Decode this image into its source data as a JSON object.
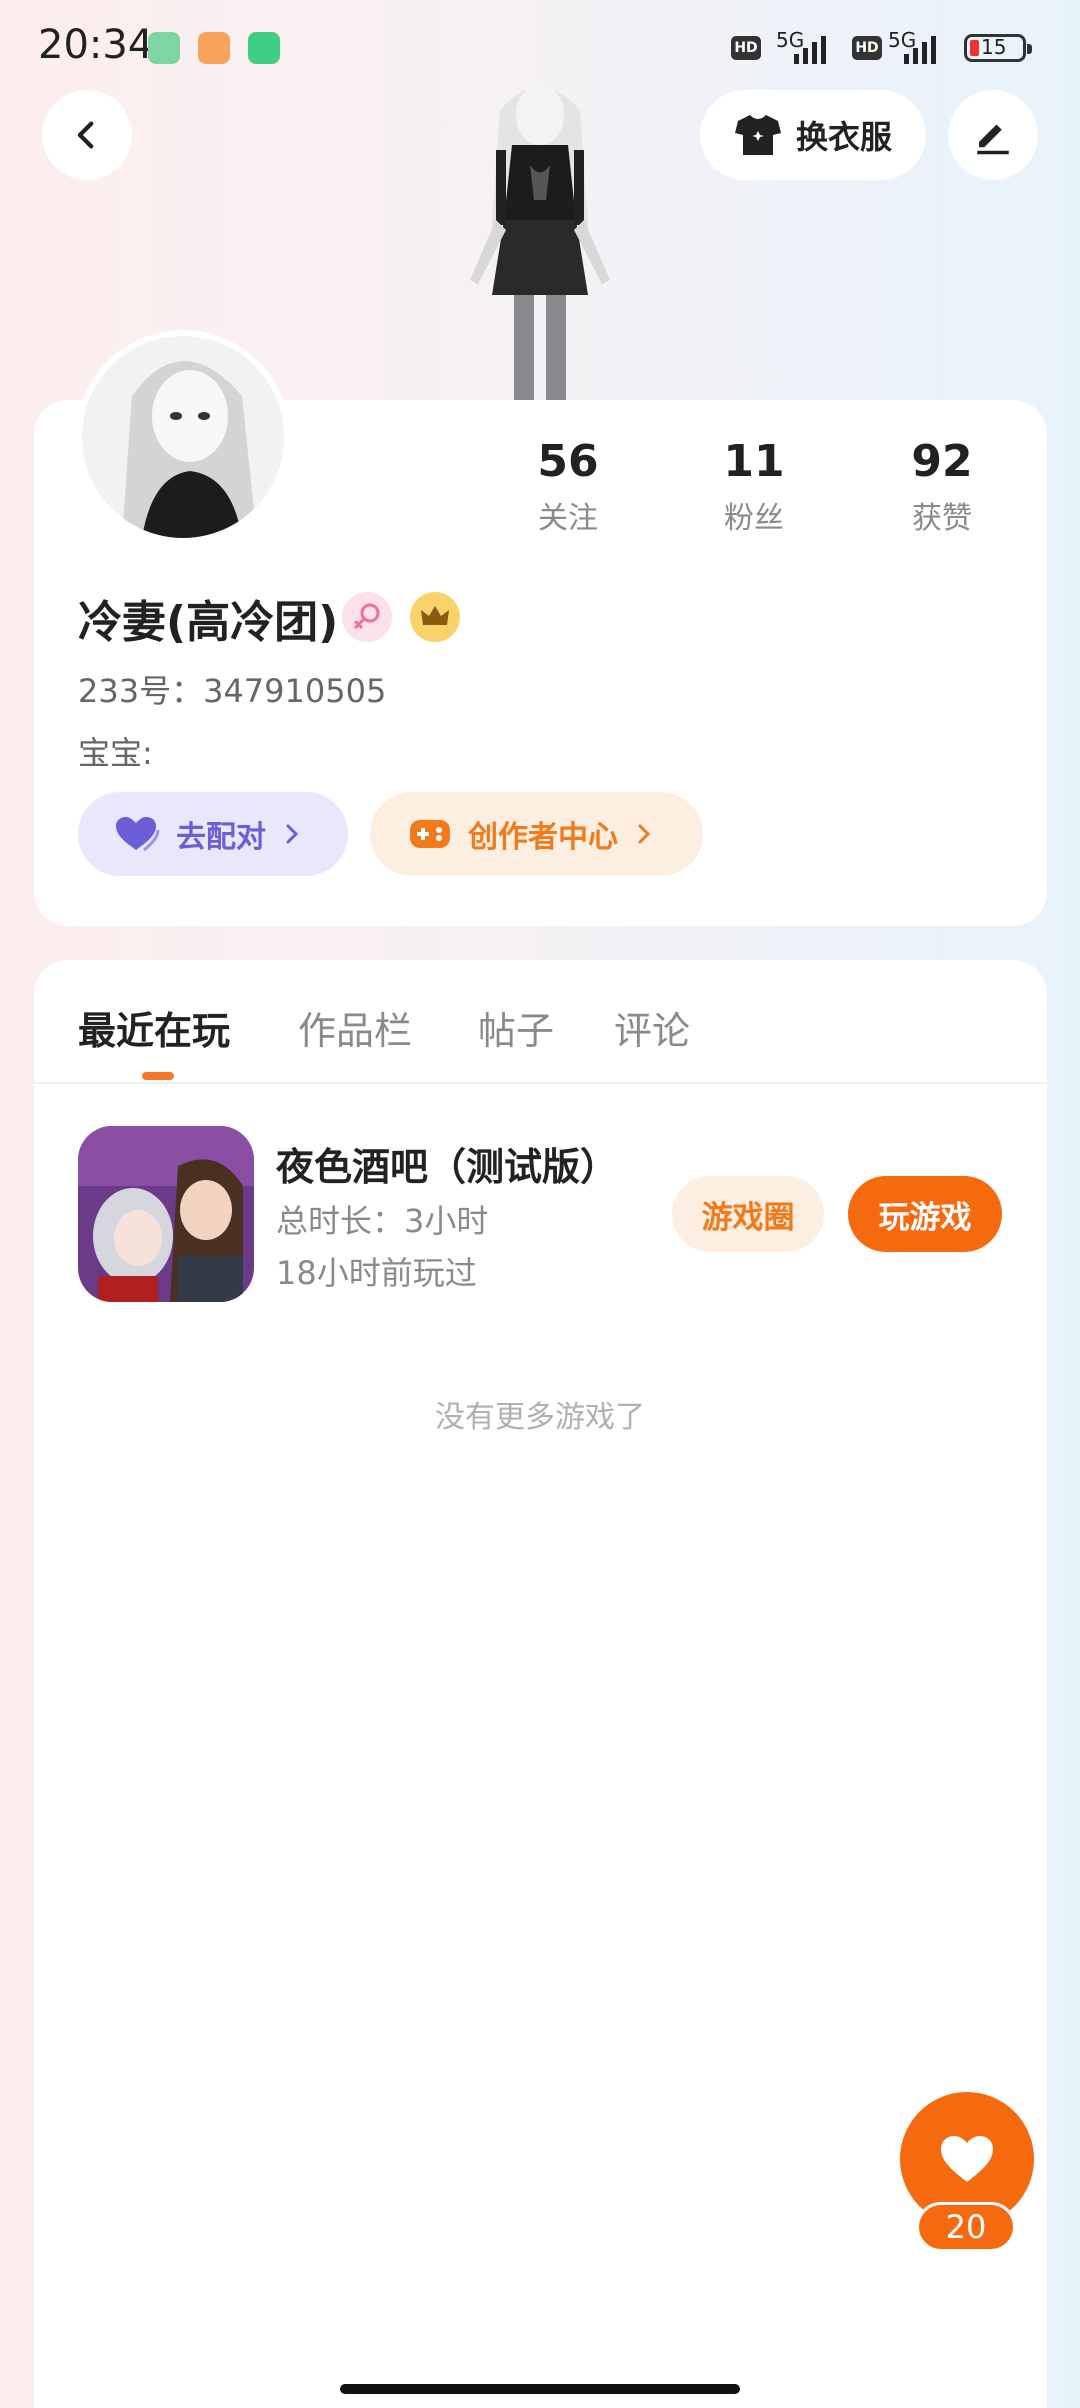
{
  "status_bar": {
    "time": "20:34",
    "net1": "5G",
    "net2": "5G",
    "hd1": "HD",
    "hd2": "HD",
    "battery": "15"
  },
  "header": {
    "dress_label": "换衣服"
  },
  "profile": {
    "stats": [
      {
        "value": "56",
        "label": "关注"
      },
      {
        "value": "11",
        "label": "粉丝"
      },
      {
        "value": "92",
        "label": "获赞"
      }
    ],
    "nickname": "冷妻(高冷团)",
    "uid": "233号：347910505",
    "baby": "宝宝:",
    "match_label": "去配对",
    "creator_label": "创作者中心"
  },
  "tabs": [
    {
      "label": "最近在玩",
      "active": true
    },
    {
      "label": "作品栏",
      "active": false
    },
    {
      "label": "帖子",
      "active": false
    },
    {
      "label": "评论",
      "active": false
    }
  ],
  "games": [
    {
      "title": "夜色酒吧（测试版）",
      "total_time": "总时长：3小时",
      "last_played": "18小时前玩过",
      "circle_label": "游戏圈",
      "play_label": "玩游戏"
    }
  ],
  "empty_hint": "没有更多游戏了",
  "like_count": "20",
  "colors": {
    "accent": "#f5690f",
    "accent_soft": "#fdeee2",
    "match": "#6a5fd8",
    "match_soft": "#e9e7fb"
  }
}
